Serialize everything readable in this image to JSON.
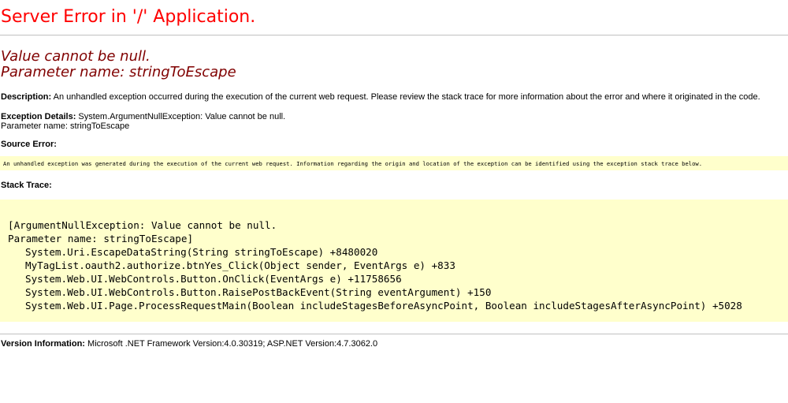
{
  "page_title": "Server Error in '/' Application.",
  "error": {
    "line1": "Value cannot be null.",
    "line2": "Parameter name: stringToEscape"
  },
  "description": {
    "label": "Description:",
    "text": "An unhandled exception occurred during the execution of the current web request. Please review the stack trace for more information about the error and where it originated in the code."
  },
  "exception_details": {
    "label": "Exception Details:",
    "text": "System.ArgumentNullException: Value cannot be null.",
    "param_line": "Parameter name: stringToEscape"
  },
  "source_error": {
    "label": "Source Error:",
    "text": "An unhandled exception was generated during the execution of the current web request. Information regarding the origin and location of the exception can be identified using the exception stack trace below."
  },
  "stack_trace": {
    "label": "Stack Trace:",
    "lines": [
      "[ArgumentNullException: Value cannot be null.",
      "Parameter name: stringToEscape]",
      "System.Uri.EscapeDataString(String stringToEscape) +8480020",
      "MyTagList.oauth2.authorize.btnYes_Click(Object sender, EventArgs e) +833",
      "System.Web.UI.WebControls.Button.OnClick(EventArgs e) +11758656",
      "System.Web.UI.WebControls.Button.RaisePostBackEvent(String eventArgument) +150",
      "System.Web.UI.Page.ProcessRequestMain(Boolean includeStagesBeforeAsyncPoint, Boolean includeStagesAfterAsyncPoint) +5028"
    ]
  },
  "version_information": {
    "label": "Version Information:",
    "text": "Microsoft .NET Framework Version:4.0.30319; ASP.NET Version:4.7.3062.0"
  },
  "colors": {
    "title": "#ff0000",
    "error_heading": "#800000",
    "code_background": "#ffffcc",
    "rule": "#c0c0c0"
  }
}
